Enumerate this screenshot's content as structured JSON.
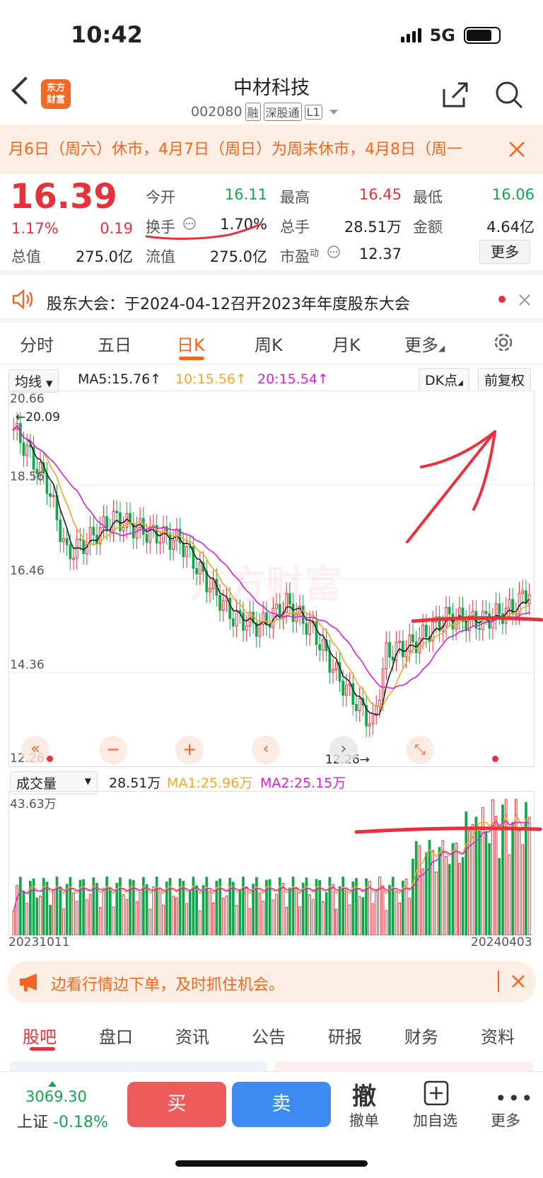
{
  "status": {
    "time": "10:42",
    "network": "5G"
  },
  "header": {
    "logo_line1": "东方",
    "logo_line2": "财富",
    "title": "中材科技",
    "code": "002080",
    "tags": [
      "融",
      "深股通",
      "L1"
    ]
  },
  "notice": {
    "text": "月6日（周六）休市，4月7日（周日）为周末休市，4月8日（周一"
  },
  "quote": {
    "price": "16.39",
    "change_pct": "1.17%",
    "change": "0.19",
    "rows": [
      [
        {
          "label": "今开",
          "value": "16.11",
          "color": "green"
        },
        {
          "label": "最高",
          "value": "16.45",
          "color": "red"
        },
        {
          "label": "最低",
          "value": "16.06",
          "color": "green"
        }
      ],
      [
        {
          "label": "换手",
          "value": "1.70%",
          "color": "dark"
        },
        {
          "label": "总手",
          "value": "28.51万",
          "color": "dark"
        },
        {
          "label": "金额",
          "value": "4.64亿",
          "color": "dark"
        }
      ],
      [
        {
          "label": "总值",
          "value": "275.0亿",
          "color": "dark"
        },
        {
          "label": "流值",
          "value": "275.0亿",
          "color": "dark"
        },
        {
          "label": "市盈",
          "value": "12.37",
          "color": "dark",
          "sup": "动"
        }
      ]
    ],
    "more_label": "更多"
  },
  "announcement": {
    "text": "股东大会：于2024-04-12召开2023年年度股东大会"
  },
  "ktabs": [
    "分时",
    "五日",
    "日K",
    "周K",
    "月K",
    "更多"
  ],
  "ktab_active": 2,
  "chart_header": {
    "ma_select": "均线",
    "ma5": "MA5:15.76↑",
    "ma10": "10:15.56↑",
    "ma20": "20:15.54↑",
    "dk": "DK点",
    "fq": "前复权"
  },
  "price_axis": {
    "top": "20.66",
    "l2": "18.56",
    "l3": "16.46",
    "l4": "14.36",
    "bottom": "12.26"
  },
  "price_marks": {
    "high": "←20.09",
    "low": "12.26→"
  },
  "watermark": "东方财富",
  "volume_header": {
    "select": "成交量",
    "value": "28.51万",
    "ma1": "MA1:25.96万",
    "ma2": "MA2:25.15万",
    "max": "43.63万"
  },
  "date_range": {
    "start": "20231011",
    "end": "20240403"
  },
  "promo": {
    "text": "边看行情边下单，及时抓住机会。"
  },
  "btabs": [
    "股吧",
    "盘口",
    "资讯",
    "公告",
    "研报",
    "财务",
    "资料"
  ],
  "btab_active": 0,
  "bottom_bar": {
    "index_value": "3069.30",
    "index_name": "上证",
    "index_change": "-0.18%",
    "buy": "买",
    "sell": "卖",
    "cancel_glyph": "撤",
    "cancel": "撤单",
    "add_watch": "加自选",
    "more": "更多"
  },
  "colors": {
    "up": "#e8313a",
    "down": "#13a64c",
    "accent": "#f2661f",
    "ma5": "#222222",
    "ma10": "#f5a623",
    "ma20": "#d81ed8"
  },
  "chart_data": {
    "type": "candlestick",
    "y_range": [
      12.26,
      20.66
    ],
    "annotations": [
      "←20.09",
      "12.26→"
    ],
    "ma": {
      "MA5": 15.76,
      "MA10": 15.56,
      "MA20": 15.54
    },
    "volume_max": "43.63万",
    "x_range": [
      "20231011",
      "20240403"
    ]
  }
}
